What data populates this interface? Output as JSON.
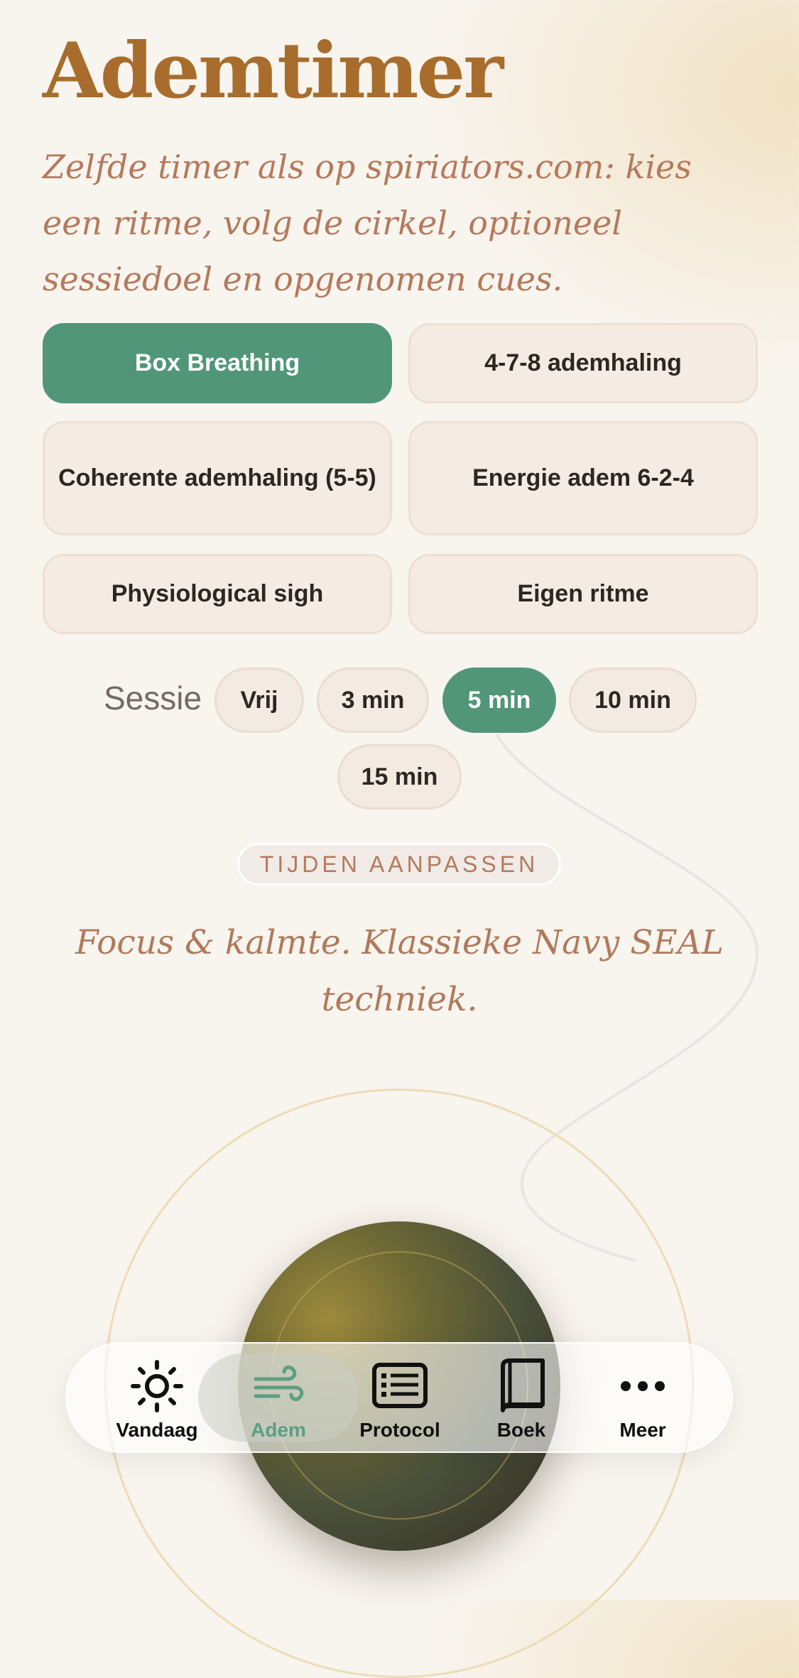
{
  "header": {
    "title": "Ademtimer",
    "subtitle": "Zelfde timer als op spiriators.com: kies een ritme, volg de cirkel, optioneel sessiedoel en opgenomen cues."
  },
  "rhythms": [
    {
      "label": "Box Breathing",
      "active": true
    },
    {
      "label": "4-7-8 ademhaling",
      "active": false
    },
    {
      "label": "Coherente ademhaling (5-5)",
      "active": false
    },
    {
      "label": "Energie adem 6-2-4",
      "active": false
    },
    {
      "label": "Physiological sigh",
      "active": false
    },
    {
      "label": "Eigen ritme",
      "active": false
    }
  ],
  "session": {
    "label": "Sessie",
    "options": [
      {
        "label": "Vrij",
        "active": false
      },
      {
        "label": "3 min",
        "active": false
      },
      {
        "label": "5 min",
        "active": true
      },
      {
        "label": "10 min",
        "active": false
      },
      {
        "label": "15 min",
        "active": false
      }
    ]
  },
  "customize_label": "TIJDEN AANPASSEN",
  "description": "Focus & kalmte. Klassieke Navy SEAL techniek.",
  "nav": {
    "items": [
      {
        "label": "Vandaag",
        "icon": "sun-icon",
        "active": false
      },
      {
        "label": "Adem",
        "icon": "wind-icon",
        "active": true
      },
      {
        "label": "Protocol",
        "icon": "list-icon",
        "active": false
      },
      {
        "label": "Boek",
        "icon": "book-icon",
        "active": false
      },
      {
        "label": "Meer",
        "icon": "more-icon",
        "active": false
      }
    ]
  },
  "colors": {
    "accent": "#519679",
    "title": "#a86d2c",
    "subtitle": "#b5795c",
    "background": "#f8f4ee"
  }
}
